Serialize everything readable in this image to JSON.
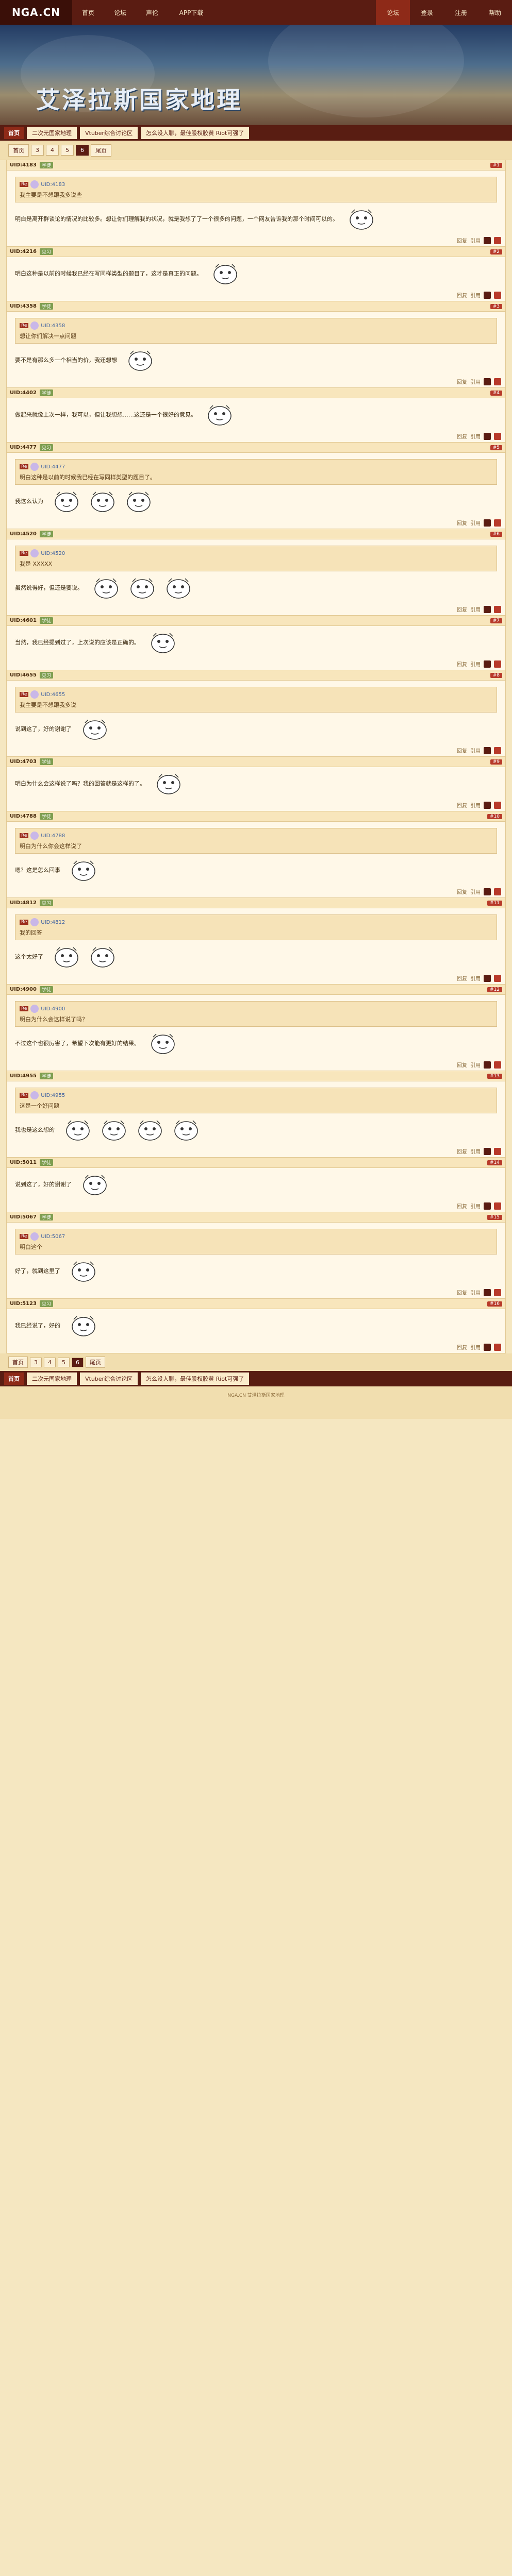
{
  "logo": "NGA.CN",
  "topnav": [
    "首页",
    "论坛",
    "声伦",
    "APP下载"
  ],
  "topright": [
    "论坛",
    "登录",
    "注册",
    "帮助"
  ],
  "banner_title": "艾泽拉斯国家地理",
  "tabs": [
    "二次元国家地理",
    "Vtuber综合讨论区",
    "怎么没人聊，最佳股权胶黄 Riot可强了"
  ],
  "home_tab": "首页",
  "pager": [
    "首页",
    "3",
    "4",
    "5",
    "6",
    "尾页"
  ],
  "posts": [
    {
      "uid": "UID:4183",
      "lvl": "学徒",
      "floor": "#1",
      "text": "明白是离开群谈论的情况的比较多。想让你们理解我的状况，就是我想了了一个很多的问题，一个网友告诉我的那个时间可以的。",
      "quote": "我主要是不想跟我多说些",
      "stickers": 1
    },
    {
      "uid": "UID:4216",
      "lvl": "见习",
      "floor": "#2",
      "text": "明白这种是以前的时候我已经在写同样类型的题目了，这才是真正的问题。",
      "quote": "",
      "stickers": 1
    },
    {
      "uid": "UID:4358",
      "lvl": "学徒",
      "floor": "#3",
      "text": "要不是有那么多一个相当的价，我还想想",
      "quote": "想让你们解决一点问题",
      "stickers": 1
    },
    {
      "uid": "UID:4402",
      "lvl": "学徒",
      "floor": "#4",
      "text": "做起来就像上次一样，我可以，但让我想想……这还是一个很好的意见。",
      "quote": "",
      "stickers": 1
    },
    {
      "uid": "UID:4477",
      "lvl": "见习",
      "floor": "#5",
      "text": "我这么认为",
      "quote": "明白这种是以前的时候我已经在写同样类型的题目了。",
      "stickers": 3
    },
    {
      "uid": "UID:4520",
      "lvl": "学徒",
      "floor": "#6",
      "text": "虽然说得好，但还是要说。",
      "quote": "我是 XXXXX",
      "stickers": 3
    },
    {
      "uid": "UID:4601",
      "lvl": "学徒",
      "floor": "#7",
      "text": "当然，我已经提到过了，上次说的应该是正确的。",
      "quote": "",
      "stickers": 1
    },
    {
      "uid": "UID:4655",
      "lvl": "见习",
      "floor": "#8",
      "text": "说到这了，好的谢谢了",
      "quote": "我主要是不想跟我多说",
      "stickers": 1
    },
    {
      "uid": "UID:4703",
      "lvl": "学徒",
      "floor": "#9",
      "text": "明白为什么会这样说了吗？我的回答就是这样的了。",
      "quote": "",
      "stickers": 1
    },
    {
      "uid": "UID:4788",
      "lvl": "学徒",
      "floor": "#10",
      "text": "嗯？这是怎么回事",
      "quote": "明白为什么你会这样说了",
      "stickers": 1
    },
    {
      "uid": "UID:4812",
      "lvl": "见习",
      "floor": "#11",
      "text": "这个太好了",
      "quote": "我的回答",
      "stickers": 2
    },
    {
      "uid": "UID:4900",
      "lvl": "学徒",
      "floor": "#12",
      "text": "不过这个也很厉害了，希望下次能有更好的结果。",
      "quote": "明白为什么会这样说了吗？",
      "stickers": 1
    },
    {
      "uid": "UID:4955",
      "lvl": "学徒",
      "floor": "#13",
      "text": "我也是这么想的",
      "quote": "这是一个好问题",
      "stickers": 4
    },
    {
      "uid": "UID:5011",
      "lvl": "学徒",
      "floor": "#14",
      "text": "说到这了，好的谢谢了",
      "quote": "",
      "stickers": 1
    },
    {
      "uid": "UID:5067",
      "lvl": "学徒",
      "floor": "#15",
      "text": "好了，就到这里了",
      "quote": "明白这个",
      "stickers": 1
    },
    {
      "uid": "UID:5123",
      "lvl": "见习",
      "floor": "#16",
      "text": "我已经说了，好的",
      "quote": "",
      "stickers": 1
    }
  ],
  "reply_label": "回复",
  "quote_label": "引用",
  "footer": "NGA.CN 艾泽拉斯国家地理"
}
